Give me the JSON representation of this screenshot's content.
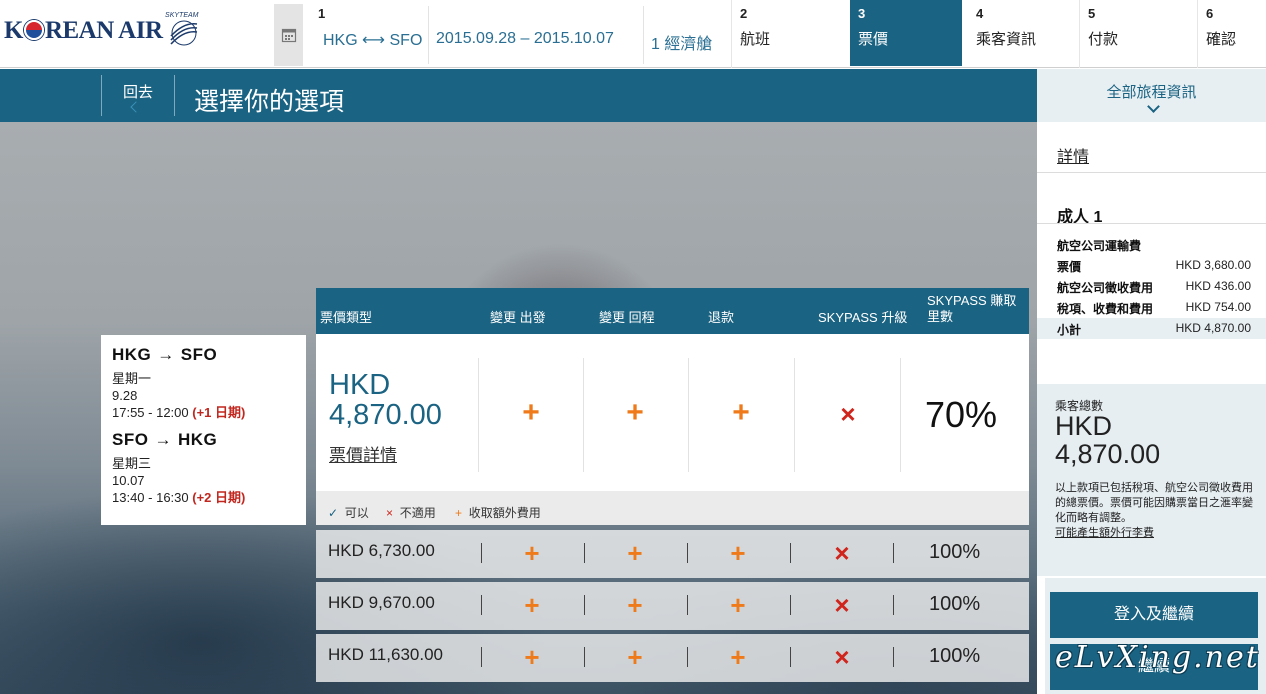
{
  "header": {
    "logo_text_pre": "K",
    "logo_text_post": "REAN AIR",
    "logo_small": "SKYTEAM",
    "steps": [
      {
        "num": "1",
        "route": "HKG ⟷ SFO",
        "dates": "2015.09.28 – 2015.10.07",
        "pax": "1 經濟艙"
      },
      {
        "num": "2",
        "label": "航班"
      },
      {
        "num": "3",
        "label": "票價"
      },
      {
        "num": "4",
        "label": "乘客資訊"
      },
      {
        "num": "5",
        "label": "付款"
      },
      {
        "num": "6",
        "label": "確認"
      }
    ]
  },
  "titlebar": {
    "back": "回去",
    "title": "選擇你的選項"
  },
  "itinerary": [
    {
      "from": "HKG",
      "to": "SFO",
      "arrow": "→",
      "day": "星期一",
      "date": "9.28",
      "time": "17:55 - 12:00",
      "plus": "(+1 日期)"
    },
    {
      "from": "SFO",
      "to": "HKG",
      "arrow": "→",
      "day": "星期三",
      "date": "10.07",
      "time": "13:40 - 16:30",
      "plus": "(+2 日期)"
    }
  ],
  "fare_table": {
    "headers": {
      "fare_type": "票價類型",
      "change_out": "變更 出發",
      "change_ret": "變更 回程",
      "refund": "退款",
      "upgrade": "SKYPASS 升級",
      "earn_1": "SKYPASS 賺取",
      "earn_2": "里數"
    },
    "selected": {
      "currency": "HKD",
      "amount": "4,870.00",
      "detail_link": "票價詳情",
      "marks": [
        "+",
        "+",
        "+",
        "×"
      ],
      "earn": "70%"
    },
    "legend": [
      {
        "icon": "✓",
        "text": "可以"
      },
      {
        "icon": "×",
        "text": "不適用"
      },
      {
        "icon": "+",
        "text": "收取額外費用"
      }
    ],
    "rows": [
      {
        "price": "HKD 6,730.00",
        "marks": [
          "+",
          "+",
          "+",
          "×"
        ],
        "earn": "100%"
      },
      {
        "price": "HKD 9,670.00",
        "marks": [
          "+",
          "+",
          "+",
          "×"
        ],
        "earn": "100%"
      },
      {
        "price": "HKD 11,630.00",
        "marks": [
          "+",
          "+",
          "+",
          "×"
        ],
        "earn": "100%"
      }
    ]
  },
  "sidebar": {
    "all_info": "全部旅程資訊",
    "details": "詳情",
    "adult": "成人 1",
    "airfare_heading": "航空公司運輸費",
    "lines": [
      {
        "k": "票價",
        "v": "HKD 3,680.00"
      },
      {
        "k": "航空公司徵收費用",
        "v": "HKD 436.00"
      },
      {
        "k": "稅項、收費和費用",
        "v": "HKD 754.00"
      },
      {
        "k": "小計",
        "v": "HKD 4,870.00"
      }
    ],
    "total_label": "乘客總數",
    "total_currency": "HKD",
    "total_amount": "4,870.00",
    "note": "以上款項已包括稅項、航空公司徵收費用 的總票價。票價可能因購票當日之滙率變化而略有調整。",
    "note_link": "可能產生額外行李費",
    "login_button": "登入及繼續",
    "continue_button": "繼續"
  },
  "watermark": "eLvXing.net",
  "colors": {
    "primary": "#1b6382",
    "plus": "#ee7a1a",
    "cross": "#d0251c",
    "date_plus": "#c0271f"
  }
}
